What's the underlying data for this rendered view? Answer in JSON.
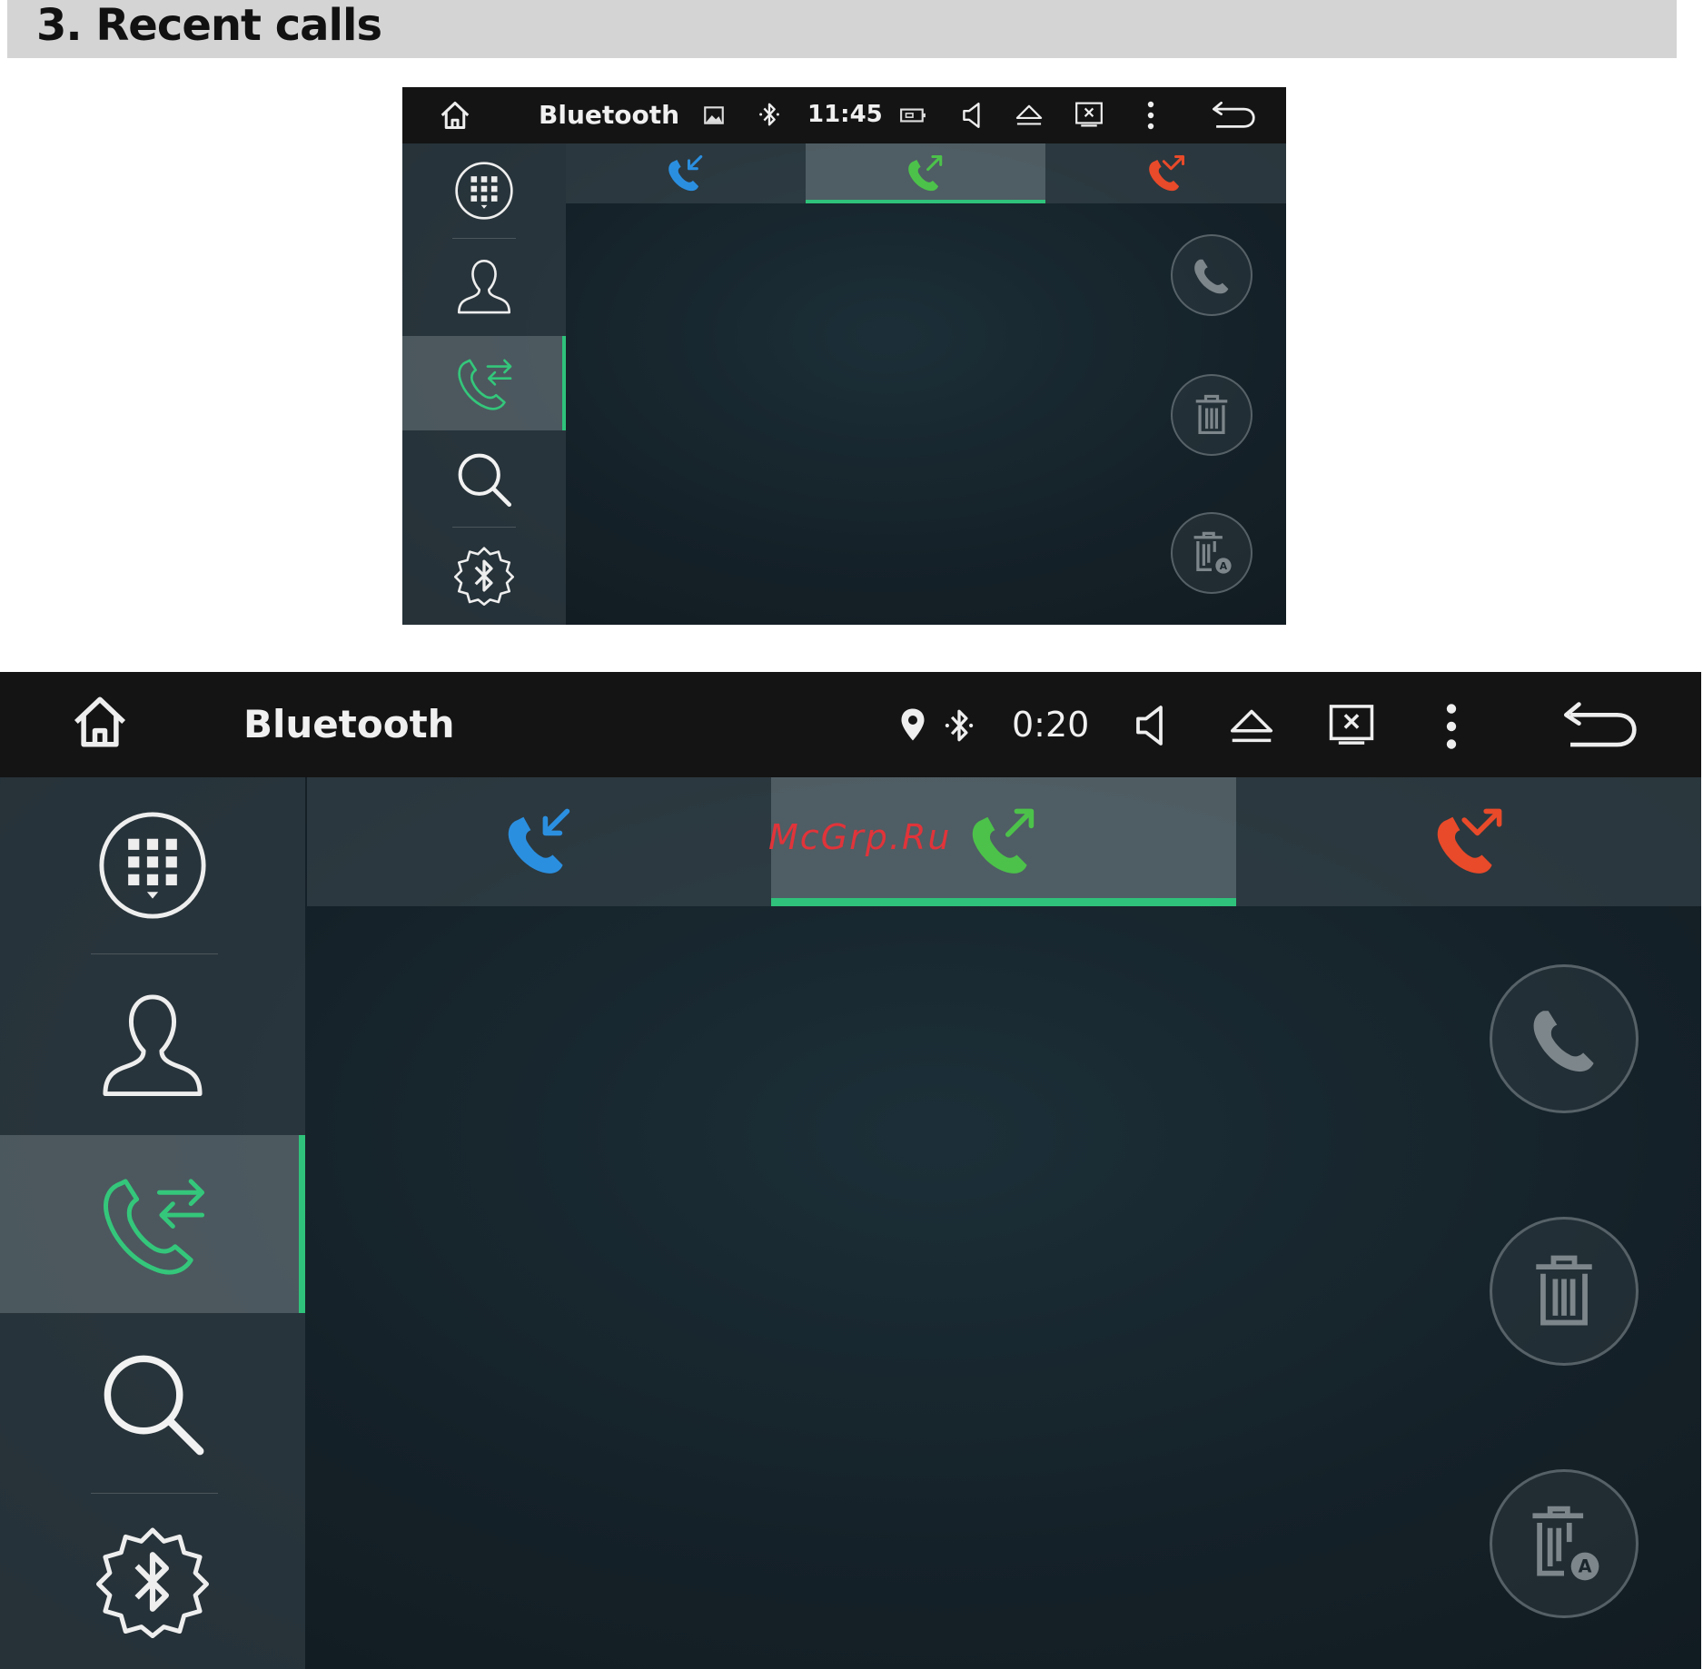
{
  "section": {
    "title": "3. Recent calls"
  },
  "screens": [
    {
      "status_bar": {
        "app_title": "Bluetooth",
        "time": "11:45"
      },
      "sidebar": {
        "items": [
          {
            "icon": "dialpad-icon"
          },
          {
            "icon": "contacts-icon"
          },
          {
            "icon": "recent-calls-icon",
            "active": true
          },
          {
            "icon": "search-icon"
          },
          {
            "icon": "bluetooth-settings-icon"
          }
        ]
      },
      "tabs": [
        {
          "icon": "incoming-call-icon",
          "color": "#2b8fe0"
        },
        {
          "icon": "outgoing-call-icon",
          "color": "#4cc24a",
          "active": true
        },
        {
          "icon": "missed-call-icon",
          "color": "#e84a2a"
        }
      ],
      "actions": [
        "call-icon",
        "delete-icon",
        "delete-all-icon"
      ]
    },
    {
      "status_bar": {
        "app_title": "Bluetooth",
        "time": "0:20"
      },
      "sidebar": {
        "items": [
          {
            "icon": "dialpad-icon"
          },
          {
            "icon": "contacts-icon"
          },
          {
            "icon": "recent-calls-icon",
            "active": true
          },
          {
            "icon": "search-icon"
          },
          {
            "icon": "bluetooth-settings-icon"
          }
        ]
      },
      "tabs": [
        {
          "icon": "incoming-call-icon",
          "color": "#2b8fe0"
        },
        {
          "icon": "outgoing-call-icon",
          "color": "#4cc24a",
          "active": true
        },
        {
          "icon": "missed-call-icon",
          "color": "#e84a2a"
        }
      ],
      "actions": [
        "call-icon",
        "delete-icon",
        "delete-all-icon"
      ]
    }
  ],
  "watermark": "McGrp.Ru",
  "colors": {
    "accent_green": "#2fc27a",
    "incoming": "#2b8fe0",
    "outgoing": "#4cc24a",
    "missed": "#e84a2a"
  }
}
